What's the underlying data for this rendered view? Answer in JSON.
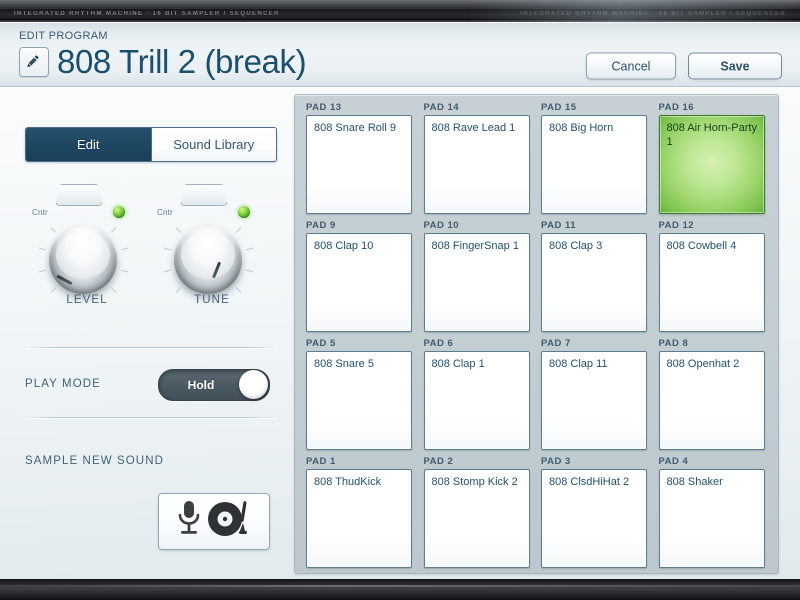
{
  "device": {
    "bezel_text": "INTEGRATED RHYTHM MACHINE  ·  16 BIT SAMPLER / SEQUENCER",
    "bezel_text_right": "INTEGRATED RHYTHM MACHINE  ·  16 BIT SAMPLER / SEQUENCER"
  },
  "header": {
    "eyebrow": "EDIT PROGRAM",
    "title": "808 Trill 2 (break)",
    "edit_icon": "pencil-icon",
    "cancel_label": "Cancel",
    "save_label": "Save"
  },
  "tabs": [
    {
      "label": "Edit",
      "active": true
    },
    {
      "label": "Sound Library",
      "active": false
    }
  ],
  "knobs": [
    {
      "label": "LEVEL",
      "center_label": "Cntr",
      "angle": -62,
      "led": "on",
      "led_color": "#7fd03f"
    },
    {
      "label": "TUNE",
      "center_label": "Cntr",
      "angle": 22,
      "led": "on",
      "led_color": "#7fd03f"
    }
  ],
  "play_mode": {
    "label": "PLAY MODE",
    "value": "Hold",
    "state": "on"
  },
  "sample_new_sound": {
    "label": "SAMPLE NEW SOUND",
    "icons": [
      "microphone-icon",
      "turntable-icon"
    ]
  },
  "pads": [
    {
      "num": "PAD 13",
      "sound": "808 Snare Roll 9",
      "selected": false
    },
    {
      "num": "PAD 14",
      "sound": "808 Rave Lead 1",
      "selected": false
    },
    {
      "num": "PAD 15",
      "sound": "808 Big Horn",
      "selected": false
    },
    {
      "num": "PAD 16",
      "sound": "808 Air Horn-Party 1",
      "selected": true
    },
    {
      "num": "PAD 9",
      "sound": "808 Clap 10",
      "selected": false
    },
    {
      "num": "PAD 10",
      "sound": "808 FingerSnap 1",
      "selected": false
    },
    {
      "num": "PAD 11",
      "sound": "808 Clap 3",
      "selected": false
    },
    {
      "num": "PAD 12",
      "sound": "808 Cowbell 4",
      "selected": false
    },
    {
      "num": "PAD 5",
      "sound": "808 Snare 5",
      "selected": false
    },
    {
      "num": "PAD 6",
      "sound": "808 Clap 1",
      "selected": false
    },
    {
      "num": "PAD 7",
      "sound": "808 Clap 11",
      "selected": false
    },
    {
      "num": "PAD 8",
      "sound": "808 Openhat 2",
      "selected": false
    },
    {
      "num": "PAD 1",
      "sound": "808 ThudKick",
      "selected": false
    },
    {
      "num": "PAD 2",
      "sound": "808 Stomp Kick 2",
      "selected": false
    },
    {
      "num": "PAD 3",
      "sound": "808 ClsdHiHat 2",
      "selected": false
    },
    {
      "num": "PAD 4",
      "sound": "808 Shaker",
      "selected": false
    }
  ],
  "colors": {
    "accent_dark_blue": "#1d4660",
    "title_blue": "#1b4f6e",
    "selected_pad_green": "#9ed66d",
    "panel_grey": "#c3ced3"
  }
}
